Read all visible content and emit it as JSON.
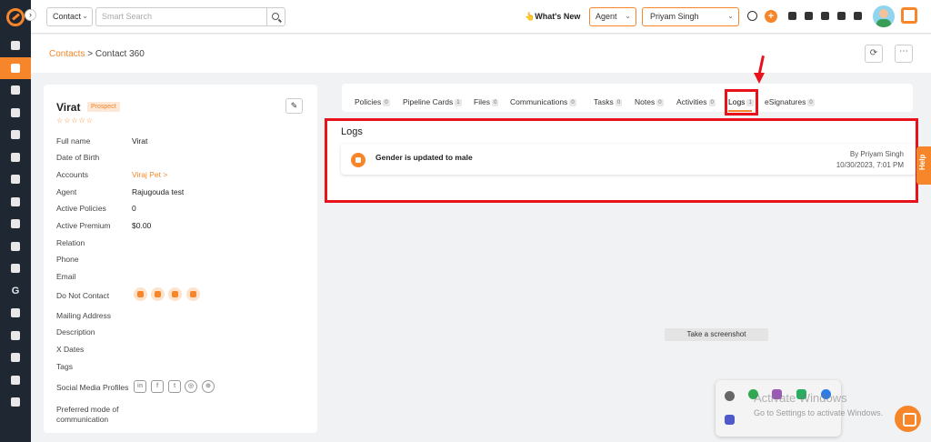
{
  "topbar": {
    "contact_select": "Contact",
    "search_placeholder": "Smart Search",
    "whats_new": "What's New",
    "agent_select": "Agent",
    "user_select": "Priyam Singh"
  },
  "breadcrumb": {
    "parent": "Contacts",
    "separator": ">",
    "current": "Contact 360"
  },
  "profile": {
    "name": "Virat",
    "badge": "Prospect",
    "stars": "☆☆☆☆☆",
    "fields": [
      {
        "label": "Full name",
        "value": "Virat"
      },
      {
        "label": "Date of Birth",
        "value": ""
      },
      {
        "label": "Accounts",
        "value": "Viraj Pet >"
      },
      {
        "label": "Agent",
        "value": "Rajugouda test"
      },
      {
        "label": "Active Policies",
        "value": "0"
      },
      {
        "label": "Active Premium",
        "value": "$0.00"
      },
      {
        "label": "Relation",
        "value": ""
      },
      {
        "label": "Phone",
        "value": ""
      },
      {
        "label": "Email",
        "value": ""
      },
      {
        "label": "Do Not Contact",
        "value": ""
      },
      {
        "label": "Mailing Address",
        "value": ""
      },
      {
        "label": "Description",
        "value": ""
      },
      {
        "label": "X Dates",
        "value": ""
      },
      {
        "label": "Tags",
        "value": ""
      },
      {
        "label": "Social Media Profiles",
        "value": ""
      },
      {
        "label": "Preferred mode of",
        "value": ""
      },
      {
        "label": "communication",
        "value": ""
      }
    ]
  },
  "tabs": [
    {
      "label": "Policies",
      "count": "0"
    },
    {
      "label": "Pipeline Cards",
      "count": "1"
    },
    {
      "label": "Files",
      "count": "0"
    },
    {
      "label": "Communications",
      "count": "0"
    },
    {
      "label": "Tasks",
      "count": "0"
    },
    {
      "label": "Notes",
      "count": "0"
    },
    {
      "label": "Activities",
      "count": "0"
    },
    {
      "label": "Logs",
      "count": "1"
    },
    {
      "label": "eSignatures",
      "count": "0"
    }
  ],
  "logs": {
    "title": "Logs",
    "entries": [
      {
        "text": "Gender is updated to male",
        "by": "By Priyam Singh",
        "time": "10/30/2023, 7:01 PM"
      }
    ]
  },
  "help_label": "Help",
  "screenshot_tip": "Take a screenshot",
  "watermark": {
    "title": "Activate Windows",
    "subtitle": "Go to Settings to activate Windows."
  },
  "colors": {
    "accent": "#f7862a",
    "highlight": "#e8121c",
    "sidebar": "#1f2733"
  },
  "icons": {
    "do_not_contact": [
      "email-icon",
      "chat-icon",
      "phone-icon",
      "sun-icon"
    ],
    "social": [
      "linkedin-icon",
      "facebook-icon",
      "twitter-icon",
      "instagram-icon",
      "globe-icon"
    ]
  }
}
